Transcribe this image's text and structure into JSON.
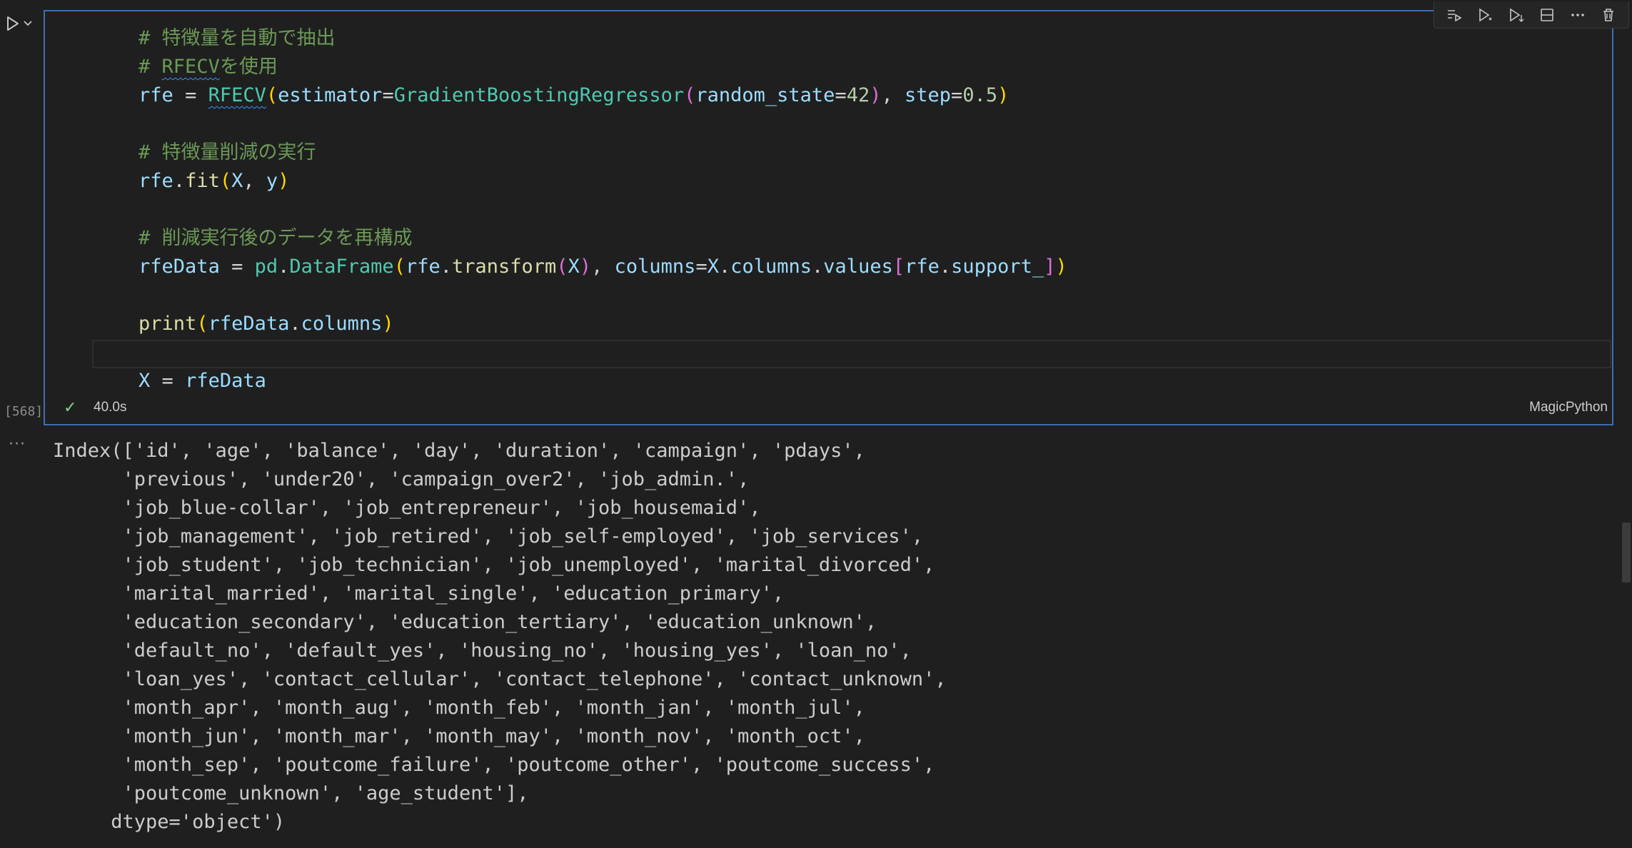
{
  "cell": {
    "execution_count": "[568]",
    "exec_time": "40.0s",
    "language": "MagicPython",
    "code_lines": [
      [
        {
          "t": "    # 特徴量を自動で抽出",
          "c": "c-cmt"
        }
      ],
      [
        {
          "t": "    # ",
          "c": "c-cmt"
        },
        {
          "t": "RFECV",
          "c": "c-cmt squiggle"
        },
        {
          "t": "を使用",
          "c": "c-cmt"
        }
      ],
      [
        {
          "t": "    ",
          "c": ""
        },
        {
          "t": "rfe",
          "c": "c-var"
        },
        {
          "t": " = ",
          "c": "c-op"
        },
        {
          "t": "RFECV",
          "c": "c-cls squiggle"
        },
        {
          "t": "(",
          "c": "c-b1"
        },
        {
          "t": "estimator",
          "c": "c-var"
        },
        {
          "t": "=",
          "c": "c-op"
        },
        {
          "t": "GradientBoostingRegressor",
          "c": "c-cls"
        },
        {
          "t": "(",
          "c": "c-b2"
        },
        {
          "t": "random_state",
          "c": "c-var"
        },
        {
          "t": "=",
          "c": "c-op"
        },
        {
          "t": "42",
          "c": "c-num"
        },
        {
          "t": ")",
          "c": "c-b2"
        },
        {
          "t": ", ",
          "c": "c-op"
        },
        {
          "t": "step",
          "c": "c-var"
        },
        {
          "t": "=",
          "c": "c-op"
        },
        {
          "t": "0.5",
          "c": "c-num"
        },
        {
          "t": ")",
          "c": "c-b1"
        }
      ],
      [
        {
          "t": "",
          "c": ""
        }
      ],
      [
        {
          "t": "    # 特徴量削減の実行",
          "c": "c-cmt"
        }
      ],
      [
        {
          "t": "    ",
          "c": ""
        },
        {
          "t": "rfe",
          "c": "c-var"
        },
        {
          "t": ".",
          "c": "c-op"
        },
        {
          "t": "fit",
          "c": "c-fn"
        },
        {
          "t": "(",
          "c": "c-b1"
        },
        {
          "t": "X",
          "c": "c-var"
        },
        {
          "t": ", ",
          "c": "c-op"
        },
        {
          "t": "y",
          "c": "c-var"
        },
        {
          "t": ")",
          "c": "c-b1"
        }
      ],
      [
        {
          "t": "",
          "c": ""
        }
      ],
      [
        {
          "t": "    # 削減実行後のデータを再構成",
          "c": "c-cmt"
        }
      ],
      [
        {
          "t": "    ",
          "c": ""
        },
        {
          "t": "rfeData",
          "c": "c-var"
        },
        {
          "t": " = ",
          "c": "c-op"
        },
        {
          "t": "pd",
          "c": "c-cls"
        },
        {
          "t": ".",
          "c": "c-op"
        },
        {
          "t": "DataFrame",
          "c": "c-cls"
        },
        {
          "t": "(",
          "c": "c-b1"
        },
        {
          "t": "rfe",
          "c": "c-var"
        },
        {
          "t": ".",
          "c": "c-op"
        },
        {
          "t": "transform",
          "c": "c-fn"
        },
        {
          "t": "(",
          "c": "c-b2"
        },
        {
          "t": "X",
          "c": "c-var"
        },
        {
          "t": ")",
          "c": "c-b2"
        },
        {
          "t": ", ",
          "c": "c-op"
        },
        {
          "t": "columns",
          "c": "c-var"
        },
        {
          "t": "=",
          "c": "c-op"
        },
        {
          "t": "X",
          "c": "c-var"
        },
        {
          "t": ".",
          "c": "c-op"
        },
        {
          "t": "columns",
          "c": "c-var"
        },
        {
          "t": ".",
          "c": "c-op"
        },
        {
          "t": "values",
          "c": "c-var"
        },
        {
          "t": "[",
          "c": "c-b2"
        },
        {
          "t": "rfe",
          "c": "c-var"
        },
        {
          "t": ".",
          "c": "c-op"
        },
        {
          "t": "support_",
          "c": "c-var"
        },
        {
          "t": "]",
          "c": "c-b2"
        },
        {
          "t": ")",
          "c": "c-b1"
        }
      ],
      [
        {
          "t": "",
          "c": ""
        }
      ],
      [
        {
          "t": "    ",
          "c": ""
        },
        {
          "t": "print",
          "c": "c-fn"
        },
        {
          "t": "(",
          "c": "c-b1"
        },
        {
          "t": "rfeData",
          "c": "c-var"
        },
        {
          "t": ".",
          "c": "c-op"
        },
        {
          "t": "columns",
          "c": "c-var"
        },
        {
          "t": ")",
          "c": "c-b1"
        }
      ],
      [
        {
          "t": "",
          "c": ""
        }
      ],
      [
        {
          "t": "    ",
          "c": ""
        },
        {
          "t": "X",
          "c": "c-var"
        },
        {
          "t": " = ",
          "c": "c-op"
        },
        {
          "t": "rfeData",
          "c": "c-var"
        }
      ]
    ]
  },
  "toolbar": {
    "icons": [
      "execute-above-icon",
      "execute-cell-icon",
      "execute-below-icon",
      "split-cell-icon",
      "more-actions-icon",
      "delete-cell-icon"
    ]
  },
  "output": {
    "ellipsis": "···",
    "lines": [
      "Index(['id', 'age', 'balance', 'day', 'duration', 'campaign', 'pdays',",
      "      'previous', 'under20', 'campaign_over2', 'job_admin.',",
      "      'job_blue-collar', 'job_entrepreneur', 'job_housemaid',",
      "      'job_management', 'job_retired', 'job_self-employed', 'job_services',",
      "      'job_student', 'job_technician', 'job_unemployed', 'marital_divorced',",
      "      'marital_married', 'marital_single', 'education_primary',",
      "      'education_secondary', 'education_tertiary', 'education_unknown',",
      "      'default_no', 'default_yes', 'housing_no', 'housing_yes', 'loan_no',",
      "      'loan_yes', 'contact_cellular', 'contact_telephone', 'contact_unknown',",
      "      'month_apr', 'month_aug', 'month_feb', 'month_jan', 'month_jul',",
      "      'month_jun', 'month_mar', 'month_may', 'month_nov', 'month_oct',",
      "      'month_sep', 'poutcome_failure', 'poutcome_other', 'poutcome_success',",
      "      'poutcome_unknown', 'age_student'],",
      "     dtype='object')"
    ]
  },
  "colors": {
    "cell_border": "#3b6fb4",
    "background": "#1f1f1f",
    "success_check": "#89d185"
  }
}
